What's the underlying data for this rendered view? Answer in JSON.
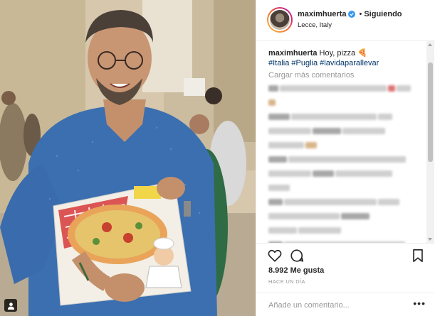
{
  "post": {
    "username": "maximhuerta",
    "separator": "•",
    "follow_state": "Siguiendo",
    "location": "Lecce, Italy",
    "caption_user": "maximhuerta",
    "caption_text": "Hoy, pizza 🍕",
    "hashtags": "#Italia #Puglia #lavidaparallevar",
    "load_more": "Cargar más comentarios",
    "likes": "8.992 Me gusta",
    "time": "HACE UN DÍA",
    "comment_placeholder": "Añade un comentario...",
    "more_options": "•••"
  },
  "icons": {
    "verified": "verified-badge-icon",
    "like": "heart-icon",
    "comment": "comment-bubble-icon",
    "save": "bookmark-icon",
    "user_tags": "user-tag-icon"
  },
  "colors": {
    "hashtag": "#003569",
    "verified": "#3897f0",
    "muted": "#999999",
    "text": "#262626"
  }
}
